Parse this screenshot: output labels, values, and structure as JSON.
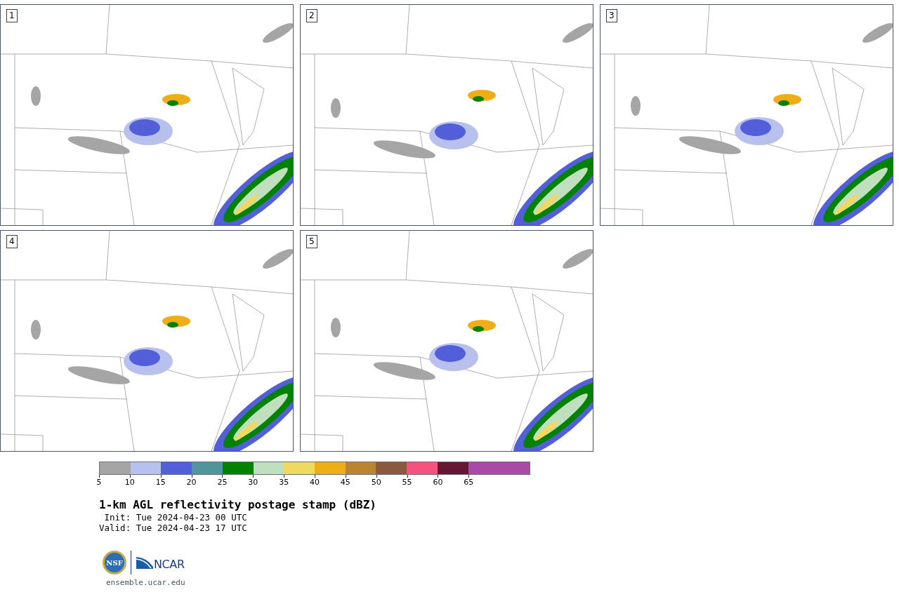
{
  "panels": [
    {
      "number": "1"
    },
    {
      "number": "2"
    },
    {
      "number": "3"
    },
    {
      "number": "4"
    },
    {
      "number": "5"
    }
  ],
  "colorbar": [
    {
      "color": "#a5a5a5",
      "label": "5"
    },
    {
      "color": "#b8c1ee",
      "label": "10"
    },
    {
      "color": "#525fd8",
      "label": "15"
    },
    {
      "color": "#4f969c",
      "label": "20"
    },
    {
      "color": "#018301",
      "label": "25"
    },
    {
      "color": "#bfdfbf",
      "label": "30"
    },
    {
      "color": "#f0da5e",
      "label": "35"
    },
    {
      "color": "#efae16",
      "label": "40"
    },
    {
      "color": "#bb8432",
      "label": "45"
    },
    {
      "color": "#8b5a3e",
      "label": "50"
    },
    {
      "color": "#f65280",
      "label": "55"
    },
    {
      "color": "#641634",
      "label": "60"
    },
    {
      "color": "#aa49a6",
      "label": "65"
    },
    {
      "color": "#aa49a6"
    }
  ],
  "title": "1-km AGL reflectivity postage stamp (dBZ)",
  "init": " Init: Tue 2024-04-23 00 UTC",
  "valid": "Valid: Tue 2024-04-23 17 UTC",
  "logos": {
    "nsf": "NSF",
    "ncar": "NCAR"
  },
  "site": "ensemble.ucar.edu"
}
